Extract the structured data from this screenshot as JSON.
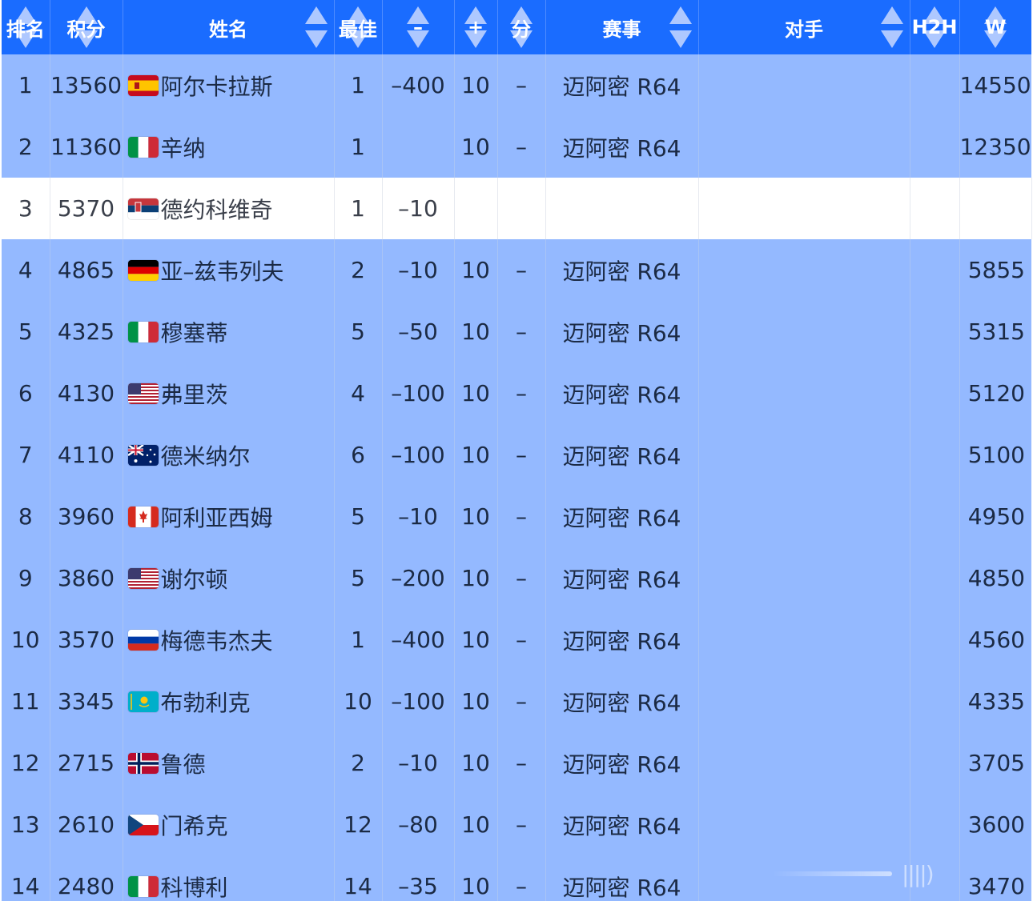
{
  "headers": {
    "rank": "排名",
    "points": "积分",
    "name": "姓名",
    "best": "最佳",
    "minus": "–",
    "plus": "+",
    "fen": "分",
    "event": "赛事",
    "opponent": "对手",
    "h2h": "H2H",
    "w": "W"
  },
  "rows": [
    {
      "rank": "1",
      "points": "13560",
      "flag": "spain-flag-icon",
      "name": "阿尔卡拉斯",
      "best": "1",
      "minus": "–400",
      "plus": "10",
      "fen": "–",
      "event": "迈阿密 R64",
      "opponent": "",
      "h2h": "",
      "w": "14550",
      "style": "blue"
    },
    {
      "rank": "2",
      "points": "11360",
      "flag": "italy-flag-icon",
      "name": "辛纳",
      "best": "1",
      "minus": "",
      "plus": "10",
      "fen": "–",
      "event": "迈阿密 R64",
      "opponent": "",
      "h2h": "",
      "w": "12350",
      "style": "blue"
    },
    {
      "rank": "3",
      "points": "5370",
      "flag": "serbia-flag-icon",
      "name": "德约科维奇",
      "best": "1",
      "minus": "–10",
      "plus": "",
      "fen": "",
      "event": "",
      "opponent": "",
      "h2h": "",
      "w": "",
      "style": "white"
    },
    {
      "rank": "4",
      "points": "4865",
      "flag": "germany-flag-icon",
      "name": "亚–兹韦列夫",
      "best": "2",
      "minus": "–10",
      "plus": "10",
      "fen": "–",
      "event": "迈阿密 R64",
      "opponent": "",
      "h2h": "",
      "w": "5855",
      "style": "blue"
    },
    {
      "rank": "5",
      "points": "4325",
      "flag": "italy-flag-icon",
      "name": "穆塞蒂",
      "best": "5",
      "minus": "–50",
      "plus": "10",
      "fen": "–",
      "event": "迈阿密 R64",
      "opponent": "",
      "h2h": "",
      "w": "5315",
      "style": "blue"
    },
    {
      "rank": "6",
      "points": "4130",
      "flag": "usa-flag-icon",
      "name": "弗里茨",
      "best": "4",
      "minus": "–100",
      "plus": "10",
      "fen": "–",
      "event": "迈阿密 R64",
      "opponent": "",
      "h2h": "",
      "w": "5120",
      "style": "blue"
    },
    {
      "rank": "7",
      "points": "4110",
      "flag": "australia-flag-icon",
      "name": "德米纳尔",
      "best": "6",
      "minus": "–100",
      "plus": "10",
      "fen": "–",
      "event": "迈阿密 R64",
      "opponent": "",
      "h2h": "",
      "w": "5100",
      "style": "blue"
    },
    {
      "rank": "8",
      "points": "3960",
      "flag": "canada-flag-icon",
      "name": "阿利亚西姆",
      "best": "5",
      "minus": "–10",
      "plus": "10",
      "fen": "–",
      "event": "迈阿密 R64",
      "opponent": "",
      "h2h": "",
      "w": "4950",
      "style": "blue"
    },
    {
      "rank": "9",
      "points": "3860",
      "flag": "usa-flag-icon",
      "name": "谢尔顿",
      "best": "5",
      "minus": "–200",
      "plus": "10",
      "fen": "–",
      "event": "迈阿密 R64",
      "opponent": "",
      "h2h": "",
      "w": "4850",
      "style": "blue"
    },
    {
      "rank": "10",
      "points": "3570",
      "flag": "russia-flag-icon",
      "name": "梅德韦杰夫",
      "best": "1",
      "minus": "–400",
      "plus": "10",
      "fen": "–",
      "event": "迈阿密 R64",
      "opponent": "",
      "h2h": "",
      "w": "4560",
      "style": "blue"
    },
    {
      "rank": "11",
      "points": "3345",
      "flag": "kazakhstan-flag-icon",
      "name": "布勃利克",
      "best": "10",
      "minus": "–100",
      "plus": "10",
      "fen": "–",
      "event": "迈阿密 R64",
      "opponent": "",
      "h2h": "",
      "w": "4335",
      "style": "blue"
    },
    {
      "rank": "12",
      "points": "2715",
      "flag": "norway-flag-icon",
      "name": "鲁德",
      "best": "2",
      "minus": "–10",
      "plus": "10",
      "fen": "–",
      "event": "迈阿密 R64",
      "opponent": "",
      "h2h": "",
      "w": "3705",
      "style": "blue"
    },
    {
      "rank": "13",
      "points": "2610",
      "flag": "czech-flag-icon",
      "name": "门希克",
      "best": "12",
      "minus": "–80",
      "plus": "10",
      "fen": "–",
      "event": "迈阿密 R64",
      "opponent": "",
      "h2h": "",
      "w": "3600",
      "style": "blue"
    },
    {
      "rank": "14",
      "points": "2480",
      "flag": "italy-flag-icon",
      "name": "科博利",
      "best": "14",
      "minus": "–35",
      "plus": "10",
      "fen": "–",
      "event": "迈阿密 R64",
      "opponent": "",
      "h2h": "",
      "w": "3470",
      "style": "blue"
    }
  ],
  "colors": {
    "header_bg": "#1a6cff",
    "row_blue": "#94b9ff",
    "row_white": "#ffffff"
  }
}
